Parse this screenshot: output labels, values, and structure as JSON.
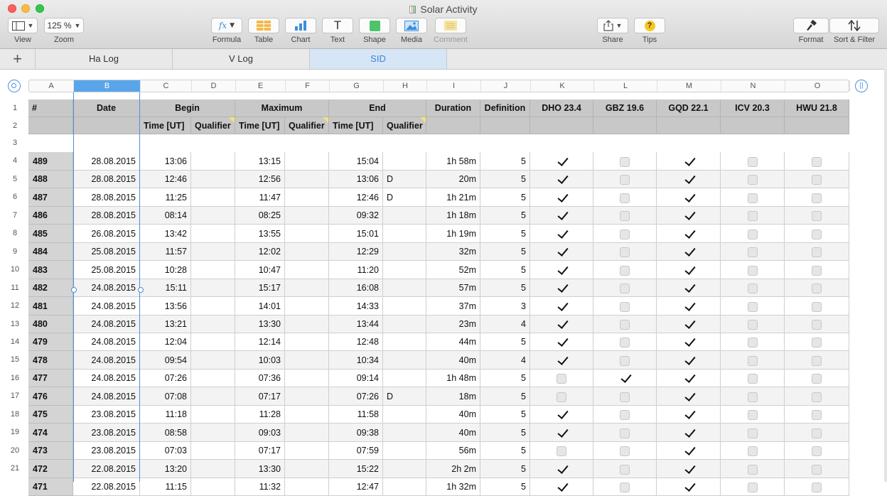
{
  "window": {
    "title": "Solar Activity"
  },
  "toolbar": {
    "view": "View",
    "zoom_value": "125 %",
    "zoom": "Zoom",
    "formula": "Formula",
    "table": "Table",
    "chart": "Chart",
    "text": "Text",
    "shape": "Shape",
    "media": "Media",
    "comment": "Comment",
    "share": "Share",
    "tips": "Tips",
    "format": "Format",
    "sort_filter": "Sort & Filter",
    "fx": "fx",
    "text_glyph": "T",
    "tips_glyph": "?"
  },
  "tabs": [
    {
      "label": "Ha Log"
    },
    {
      "label": "V Log"
    },
    {
      "label": "SID"
    }
  ],
  "columns": [
    "A",
    "B",
    "C",
    "D",
    "E",
    "F",
    "G",
    "H",
    "I",
    "J",
    "K",
    "L",
    "M",
    "N",
    "O"
  ],
  "rownums": [
    "1",
    "2",
    "3",
    "4",
    "5",
    "6",
    "7",
    "8",
    "9",
    "10",
    "11",
    "12",
    "13",
    "14",
    "15",
    "16",
    "17",
    "18",
    "19",
    "20",
    "21"
  ],
  "headers": {
    "id": "#",
    "date": "Date",
    "begin": "Begin",
    "maximum": "Maximum",
    "end": "End",
    "duration": "Duration",
    "definition": "Definition",
    "dho": "DHO 23.4",
    "gbz": "GBZ 19.6",
    "gqd": "GQD 22.1",
    "icv": "ICV 20.3",
    "hwu": "HWU 21.8",
    "time_ut": "Time [UT]",
    "qualifier": "Qualifier"
  },
  "rows": [
    {
      "id": "489",
      "date": "28.08.2015",
      "begin": "13:06",
      "bq": "",
      "max": "13:15",
      "mq": "",
      "end": "15:04",
      "eq": "",
      "dur": "1h 58m",
      "def": "5",
      "dho": true,
      "gbz": false,
      "gqd": true,
      "icv": false,
      "hwu": false
    },
    {
      "id": "488",
      "date": "28.08.2015",
      "begin": "12:46",
      "bq": "",
      "max": "12:56",
      "mq": "",
      "end": "13:06",
      "eq": "D",
      "dur": "20m",
      "def": "5",
      "dho": true,
      "gbz": false,
      "gqd": true,
      "icv": false,
      "hwu": false
    },
    {
      "id": "487",
      "date": "28.08.2015",
      "begin": "11:25",
      "bq": "",
      "max": "11:47",
      "mq": "",
      "end": "12:46",
      "eq": "D",
      "dur": "1h 21m",
      "def": "5",
      "dho": true,
      "gbz": false,
      "gqd": true,
      "icv": false,
      "hwu": false
    },
    {
      "id": "486",
      "date": "28.08.2015",
      "begin": "08:14",
      "bq": "",
      "max": "08:25",
      "mq": "",
      "end": "09:32",
      "eq": "",
      "dur": "1h 18m",
      "def": "5",
      "dho": true,
      "gbz": false,
      "gqd": true,
      "icv": false,
      "hwu": false
    },
    {
      "id": "485",
      "date": "26.08.2015",
      "begin": "13:42",
      "bq": "",
      "max": "13:55",
      "mq": "",
      "end": "15:01",
      "eq": "",
      "dur": "1h 19m",
      "def": "5",
      "dho": true,
      "gbz": false,
      "gqd": true,
      "icv": false,
      "hwu": false
    },
    {
      "id": "484",
      "date": "25.08.2015",
      "begin": "11:57",
      "bq": "",
      "max": "12:02",
      "mq": "",
      "end": "12:29",
      "eq": "",
      "dur": "32m",
      "def": "5",
      "dho": true,
      "gbz": false,
      "gqd": true,
      "icv": false,
      "hwu": false
    },
    {
      "id": "483",
      "date": "25.08.2015",
      "begin": "10:28",
      "bq": "",
      "max": "10:47",
      "mq": "",
      "end": "11:20",
      "eq": "",
      "dur": "52m",
      "def": "5",
      "dho": true,
      "gbz": false,
      "gqd": true,
      "icv": false,
      "hwu": false
    },
    {
      "id": "482",
      "date": "24.08.2015",
      "begin": "15:11",
      "bq": "",
      "max": "15:17",
      "mq": "",
      "end": "16:08",
      "eq": "",
      "dur": "57m",
      "def": "5",
      "dho": true,
      "gbz": false,
      "gqd": true,
      "icv": false,
      "hwu": false
    },
    {
      "id": "481",
      "date": "24.08.2015",
      "begin": "13:56",
      "bq": "",
      "max": "14:01",
      "mq": "",
      "end": "14:33",
      "eq": "",
      "dur": "37m",
      "def": "3",
      "dho": true,
      "gbz": false,
      "gqd": true,
      "icv": false,
      "hwu": false
    },
    {
      "id": "480",
      "date": "24.08.2015",
      "begin": "13:21",
      "bq": "",
      "max": "13:30",
      "mq": "",
      "end": "13:44",
      "eq": "",
      "dur": "23m",
      "def": "4",
      "dho": true,
      "gbz": false,
      "gqd": true,
      "icv": false,
      "hwu": false
    },
    {
      "id": "479",
      "date": "24.08.2015",
      "begin": "12:04",
      "bq": "",
      "max": "12:14",
      "mq": "",
      "end": "12:48",
      "eq": "",
      "dur": "44m",
      "def": "5",
      "dho": true,
      "gbz": false,
      "gqd": true,
      "icv": false,
      "hwu": false
    },
    {
      "id": "478",
      "date": "24.08.2015",
      "begin": "09:54",
      "bq": "",
      "max": "10:03",
      "mq": "",
      "end": "10:34",
      "eq": "",
      "dur": "40m",
      "def": "4",
      "dho": true,
      "gbz": false,
      "gqd": true,
      "icv": false,
      "hwu": false
    },
    {
      "id": "477",
      "date": "24.08.2015",
      "begin": "07:26",
      "bq": "",
      "max": "07:36",
      "mq": "",
      "end": "09:14",
      "eq": "",
      "dur": "1h 48m",
      "def": "5",
      "dho": false,
      "gbz": true,
      "gqd": true,
      "icv": false,
      "hwu": false
    },
    {
      "id": "476",
      "date": "24.08.2015",
      "begin": "07:08",
      "bq": "",
      "max": "07:17",
      "mq": "",
      "end": "07:26",
      "eq": "D",
      "dur": "18m",
      "def": "5",
      "dho": false,
      "gbz": false,
      "gqd": true,
      "icv": false,
      "hwu": false
    },
    {
      "id": "475",
      "date": "23.08.2015",
      "begin": "11:18",
      "bq": "",
      "max": "11:28",
      "mq": "",
      "end": "11:58",
      "eq": "",
      "dur": "40m",
      "def": "5",
      "dho": true,
      "gbz": false,
      "gqd": true,
      "icv": false,
      "hwu": false
    },
    {
      "id": "474",
      "date": "23.08.2015",
      "begin": "08:58",
      "bq": "",
      "max": "09:03",
      "mq": "",
      "end": "09:38",
      "eq": "",
      "dur": "40m",
      "def": "5",
      "dho": true,
      "gbz": false,
      "gqd": true,
      "icv": false,
      "hwu": false
    },
    {
      "id": "473",
      "date": "23.08.2015",
      "begin": "07:03",
      "bq": "",
      "max": "07:17",
      "mq": "",
      "end": "07:59",
      "eq": "",
      "dur": "56m",
      "def": "5",
      "dho": false,
      "gbz": false,
      "gqd": true,
      "icv": false,
      "hwu": false
    },
    {
      "id": "472",
      "date": "22.08.2015",
      "begin": "13:20",
      "bq": "",
      "max": "13:30",
      "mq": "",
      "end": "15:22",
      "eq": "",
      "dur": "2h 2m",
      "def": "5",
      "dho": true,
      "gbz": false,
      "gqd": true,
      "icv": false,
      "hwu": false
    },
    {
      "id": "471",
      "date": "22.08.2015",
      "begin": "11:15",
      "bq": "",
      "max": "11:32",
      "mq": "",
      "end": "12:47",
      "eq": "",
      "dur": "1h 32m",
      "def": "5",
      "dho": true,
      "gbz": false,
      "gqd": true,
      "icv": false,
      "hwu": false
    }
  ],
  "colors": {
    "selection": "#5aa5ea",
    "active_tab": "#3c85d6",
    "header_bg": "#c8c8c8"
  }
}
